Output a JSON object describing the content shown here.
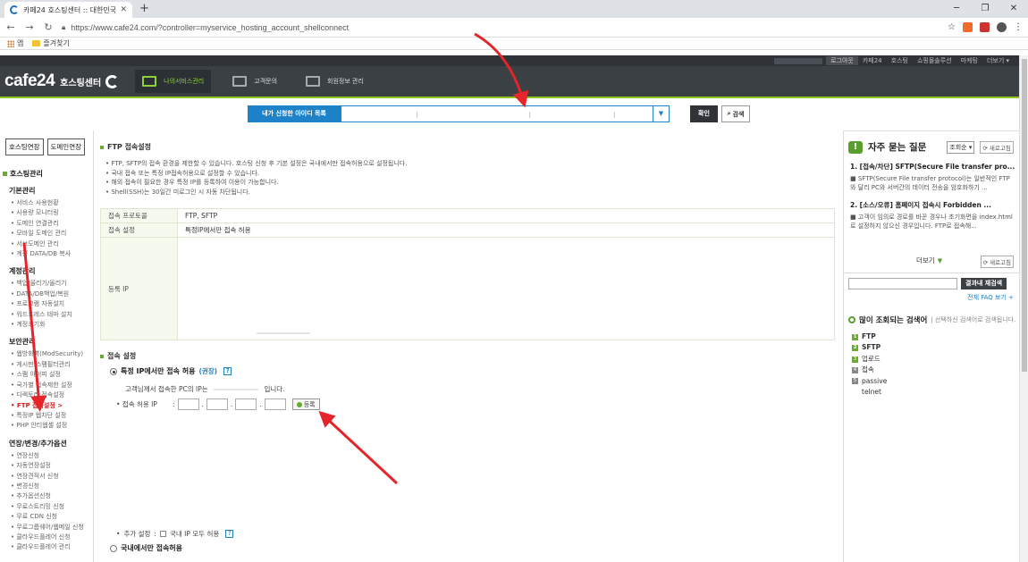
{
  "browser": {
    "tab_title": "카페24 호스팅센터 :: 대한민국 N",
    "url": "https://www.cafe24.com/?controller=myservice_hosting_account_shellconnect",
    "bookmarks": [
      "앱",
      "즐겨찾기"
    ]
  },
  "site": {
    "util_links": [
      "로그아웃",
      "카페24",
      "호스팅",
      "쇼핑몰솔루션",
      "마케팅",
      "더보기 ▾"
    ],
    "logo": "cafe24",
    "logo_sub": "호스팅센터",
    "menu": [
      "나의서비스관리",
      "고객문의",
      "회원정보 관리"
    ]
  },
  "id_search": {
    "label": "내가 신청한 아이디 목록",
    "confirm": "확인",
    "search": "검색"
  },
  "sidebar": {
    "buttons": [
      "호스팅연장",
      "도메인연장"
    ],
    "section": "호스팅관리",
    "groups": [
      {
        "title": "기본관리",
        "items": [
          "서비스 사용현황",
          "사용량 모니터링",
          "도메인 연결관리",
          "모바일 도메인 관리",
          "서브도메인 관리",
          "계정 DATA/DB 복사"
        ]
      },
      {
        "title": "계정관리",
        "items": [
          "백업/올리기/올리기",
          "DATA/DB백업/복원",
          "프로그램 자동설치",
          "워드프레스 테마 설치",
          "계정초기화"
        ]
      },
      {
        "title": "보안관리",
        "items": [
          "웹방화벽(ModSecurity)",
          "게시판 스팸필터관리",
          "스팸 아이피 설정",
          "국가별 접속제한 설정",
          "디렉토리 접속설정",
          "FTP 접속설정 >",
          "특정IP 웹차단 설정",
          "PHP 안티웹셸 설정"
        ]
      },
      {
        "title": "연장/변경/추가옵션",
        "items": [
          "연장신청",
          "자동연장설정",
          "연장견적서 신청",
          "변경신청",
          "추가옵션신청",
          "무료스트리밍 신청",
          "무료 CDN 신청",
          "무료그룹웨어/웹메일 신청",
          "클라우드플레어 신청",
          "클라우드플레어 관리"
        ]
      }
    ]
  },
  "main": {
    "title": "FTP 접속설정",
    "notes": [
      "FTP, SFTP의 접속 환경을 제한할 수 있습니다. 호스팅 신청 후 기본 설정은 국내에서만 접속허용으로 설정됩니다.",
      "국내 접속 또는 특정 IP접속허용으로 설정할 수 있습니다.",
      "해외 접속이 필요한 경우 특정 IP를 등록하여 이용이 가능합니다.",
      "Shell(SSH)는 30일간 미로그인 시 자동 차단됩니다."
    ],
    "table": [
      {
        "th": "접속 프로토콜",
        "td": "FTP, SFTP"
      },
      {
        "th": "접속 설정",
        "td": "특정IP에서만 접속 허용"
      },
      {
        "th": "등록 IP",
        "td": ""
      }
    ],
    "conn_title": "접속 설정",
    "opt_specific": "특정 IP에서만 접속 허용",
    "opt_recommended": "(권장)",
    "help": "?",
    "ip_msg_prefix": "고객님께서 접속한 PC의 IP는",
    "ip_msg_suffix": "입니다.",
    "allow_label": "접속 허용 IP",
    "register": "등록",
    "extra_label": "추가 설정",
    "extra_check": "국내 IP 모두 허용",
    "opt_domestic": "국내에서만 접속허용"
  },
  "right": {
    "faq_title": "자주 묻는 질문",
    "faq_sort": "조회순 ▾",
    "refresh": "새로고침",
    "faq": [
      {
        "q": "1. [접속/차단] SFTP(Secure File transfer pro...",
        "a": "SFTP(Secure File transfer protocol)는 일반적인 FTP와 달리 PC와 서버간의 데이터 전송을 암호화하기 ..."
      },
      {
        "q": "2. [소스/오류] 홈페이지 접속시 Forbidden ...",
        "a": "고객이 임의로 경로를 바꾼 경우나 초기화면을 index.html로 설정하지 않으신 경우입니다. FTP로 접속해..."
      }
    ],
    "more": "더보기",
    "result_search": "결과내 재검색",
    "all_faq": "전체 FAQ 보기 +",
    "popular_title": "많이 조회되는 검색어",
    "popular_sub": "선택하신 검색어로 검색됩니다.",
    "popular": [
      "FTP",
      "SFTP",
      "업로드",
      "접속",
      "passive",
      "telnet"
    ]
  },
  "colors": {
    "accent_green": "#8fc31f",
    "header_dark": "#3b4045",
    "link_blue": "#1e82c8",
    "annotation_red": "#e5252a"
  }
}
